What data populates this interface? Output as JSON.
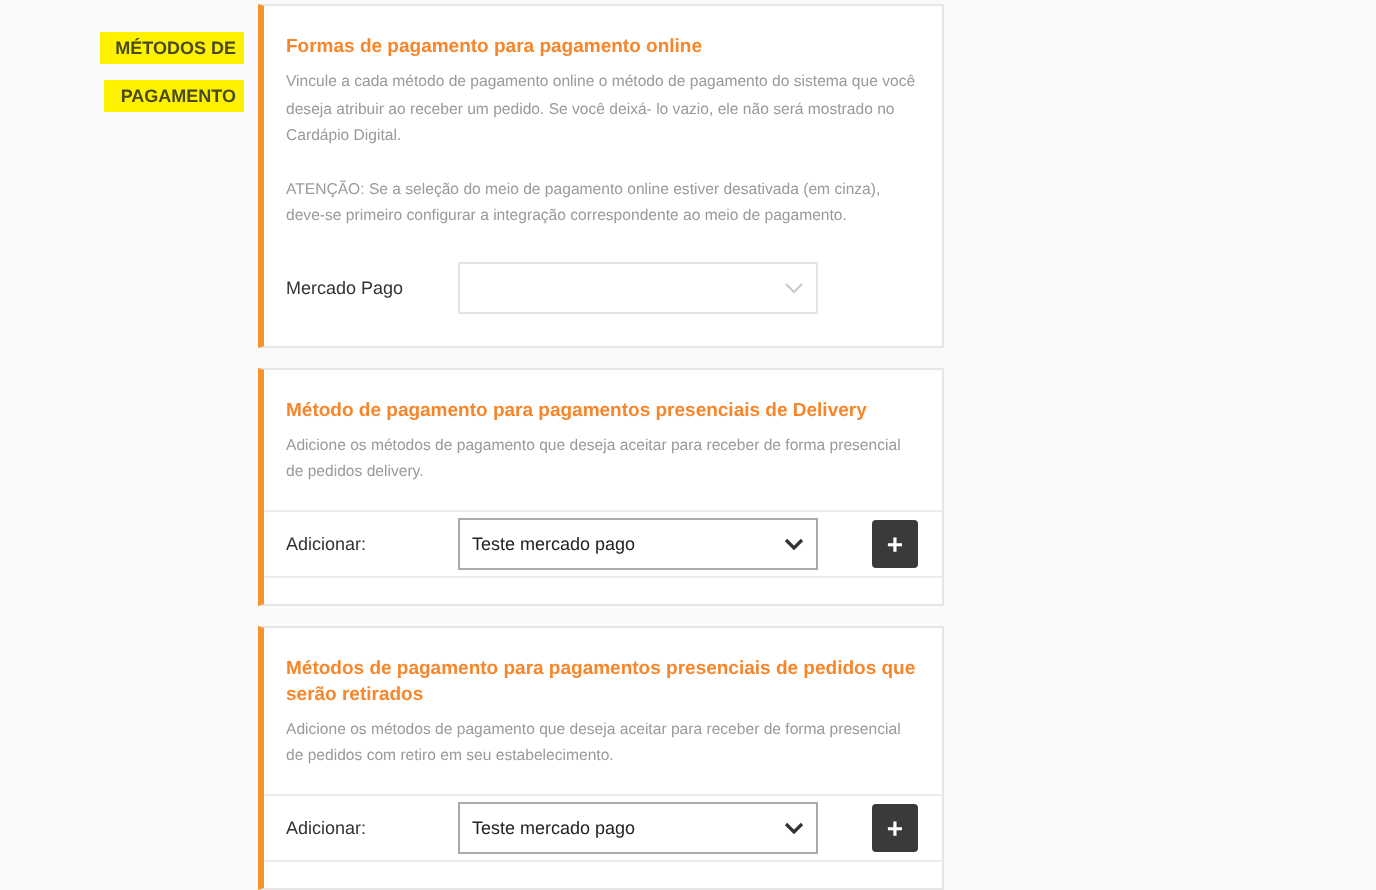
{
  "side_heading": [
    "MÉTODOS DE",
    "PAGAMENTO"
  ],
  "sections": [
    {
      "kind": "mapping",
      "title": "Formas de pagamento para pagamento online",
      "paragraphs": [
        "Vincule a cada método de pagamento online o método de pagamento do sistema que você deseja atribuir ao receber um pedido. Se você deixá- lo vazio, ele não será mostrado no Cardápio Digital.",
        "ATENÇÃO: Se a seleção do meio de pagamento online estiver desativada (em cinza), deve-se primeiro configurar a integração correspondente ao meio de pagamento."
      ],
      "field": {
        "label": "Mercado Pago",
        "disabled": true
      }
    },
    {
      "kind": "add",
      "title": "Método de pagamento para pagamentos presenciais de Delivery",
      "paragraphs": [
        "Adicione os métodos de pagamento que deseja aceitar para receber de forma presencial de pedidos delivery."
      ],
      "field": {
        "label": "Adicionar:",
        "value": "Teste mercado pago",
        "disabled": false
      },
      "add_button": "+"
    },
    {
      "kind": "add",
      "title": "Métodos de pagamento para pagamentos presenciais de pedidos que serão retirados",
      "paragraphs": [
        "Adicione os métodos de pagamento que deseja aceitar para receber de forma presencial de pedidos com retiro em seu estabelecimento."
      ],
      "field": {
        "label": "Adicionar:",
        "value": "Teste mercado pago",
        "disabled": false
      },
      "add_button": "+"
    }
  ]
}
